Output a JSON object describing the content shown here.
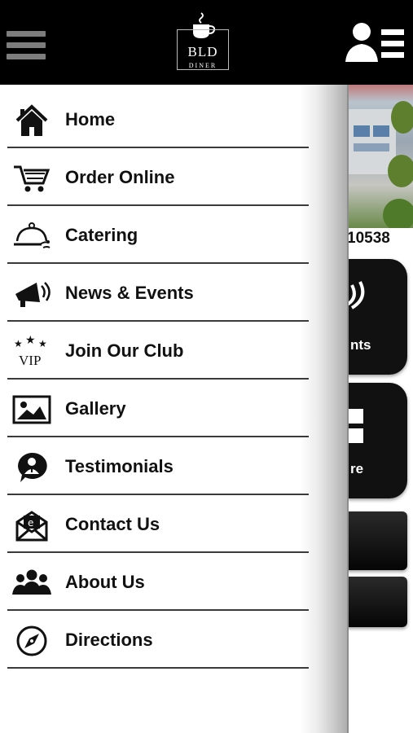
{
  "header": {
    "menu_icon": "hamburger-icon",
    "logo": {
      "name": "BLD",
      "subtitle": "DINER",
      "icon": "coffee-cup-icon"
    },
    "account_icon": "user-list-icon"
  },
  "background": {
    "phone_partial": "10538",
    "tile_label_1": "nts",
    "tile_label_2": "re"
  },
  "menu": {
    "items": [
      {
        "label": "Home",
        "icon": "home-icon"
      },
      {
        "label": "Order Online",
        "icon": "cart-icon"
      },
      {
        "label": "Catering",
        "icon": "serving-tray-icon"
      },
      {
        "label": "News & Events",
        "icon": "megaphone-icon"
      },
      {
        "label": "Join Our Club",
        "icon": "vip-stars-icon"
      },
      {
        "label": "Gallery",
        "icon": "picture-icon"
      },
      {
        "label": "Testimonials",
        "icon": "speech-person-icon"
      },
      {
        "label": "Contact Us",
        "icon": "envelope-icon"
      },
      {
        "label": "About Us",
        "icon": "people-icon"
      },
      {
        "label": "Directions",
        "icon": "compass-icon"
      }
    ]
  },
  "colors": {
    "header_bg": "#000000",
    "text": "#111111",
    "divider": "#3a3a3a"
  }
}
